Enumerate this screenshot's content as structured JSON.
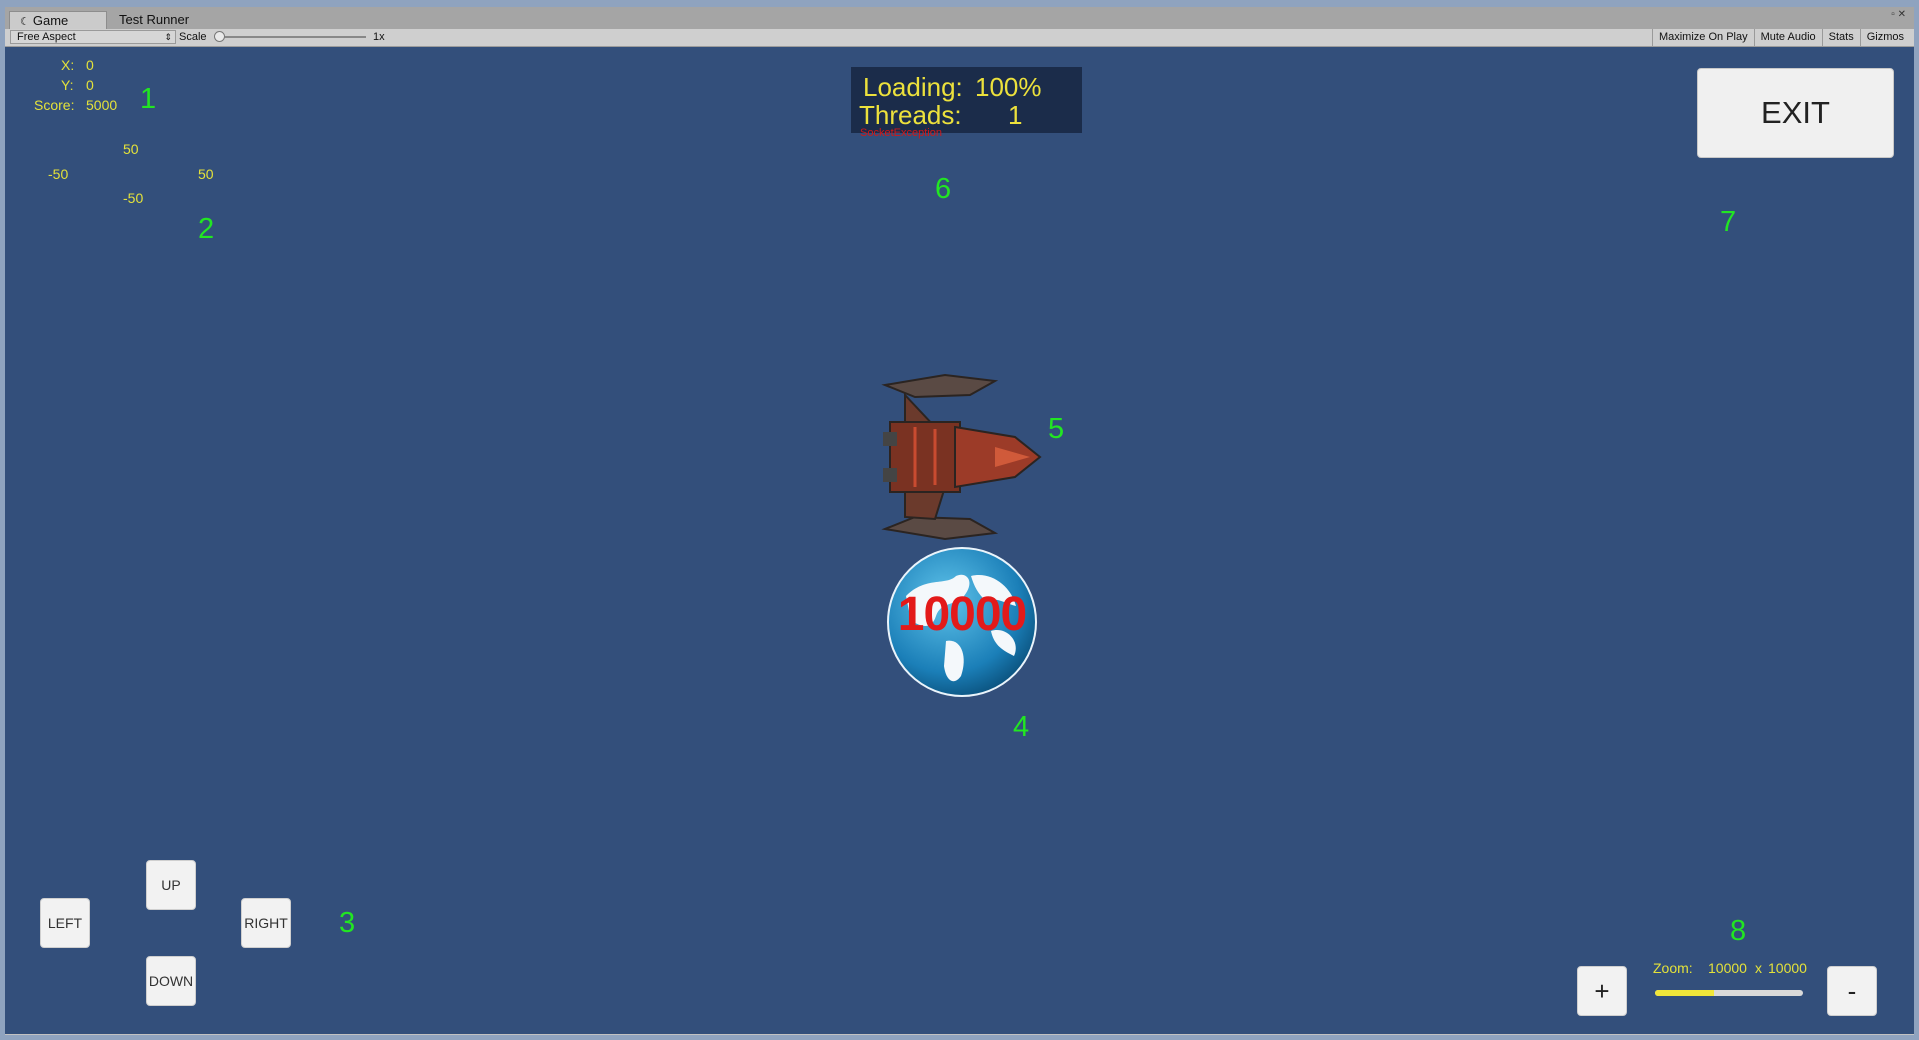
{
  "editor": {
    "tabs": [
      {
        "label": "Game",
        "active": true,
        "icon": "game-icon"
      },
      {
        "label": "Test Runner",
        "active": false
      }
    ],
    "toolbar": {
      "aspect": "Free Aspect",
      "scale_label": "Scale",
      "scale_value": "1x",
      "buttons": [
        "Maximize On Play",
        "Mute Audio",
        "Stats",
        "Gizmos"
      ]
    }
  },
  "hud": {
    "x_label": "X:",
    "x_value": "0",
    "y_label": "Y:",
    "y_value": "0",
    "score_label": "Score:",
    "score_value": "5000",
    "axis": {
      "top": "50",
      "left": "-50",
      "right": "50",
      "bottom": "-50"
    }
  },
  "loading": {
    "loading_label": "Loading:",
    "loading_value": "100%",
    "threads_label": "Threads:",
    "threads_value": "1",
    "error_text": "SocketException"
  },
  "exit_label": "EXIT",
  "world_value": "10000",
  "controls": {
    "up": "UP",
    "down": "DOWN",
    "left": "LEFT",
    "right": "RIGHT"
  },
  "zoom": {
    "label": "Zoom:",
    "width": "10000",
    "separator": "x",
    "height": "10000",
    "plus": "+",
    "minus": "-",
    "level_fraction": 0.4
  },
  "markers": [
    "1",
    "2",
    "3",
    "4",
    "5",
    "6",
    "7",
    "8"
  ],
  "colors": {
    "background": "#334f7b",
    "hud_text": "#e4e23a",
    "marker": "#22e622",
    "world_number": "#e31a1a"
  }
}
